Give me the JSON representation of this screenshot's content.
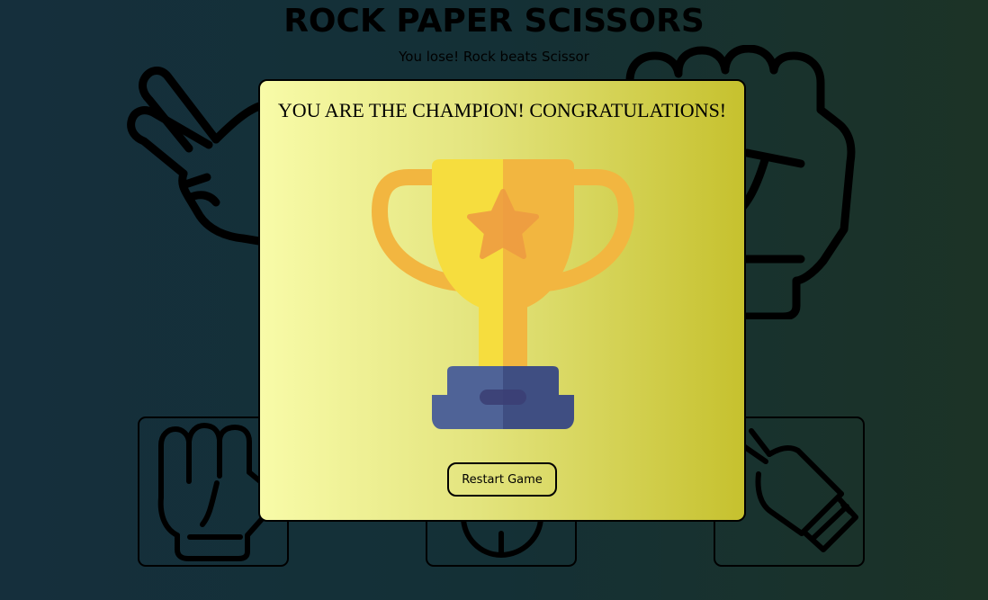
{
  "game": {
    "title": "ROCK PAPER SCISSORS",
    "round_result": "You lose! Rock beats Scissor"
  },
  "background_hands": {
    "left": "scissors-hand-icon",
    "right": "rock-fist-icon"
  },
  "choices": [
    {
      "id": "rock",
      "icon": "rock-fist-icon"
    },
    {
      "id": "paper",
      "icon": "paper-hand-icon"
    },
    {
      "id": "scissors",
      "icon": "scissors-hand-icon"
    }
  ],
  "modal": {
    "message": "YOU ARE THE CHAMPION! CONGRATULATIONS!",
    "icon": "trophy-icon",
    "restart_label": "Restart Game"
  },
  "colors": {
    "background_left": "#152f3c",
    "background_right": "#1c3326",
    "modal_gradient_left": "#f8fba8",
    "modal_gradient_right": "#c6c12e",
    "trophy_cup": "#f6dd3e",
    "trophy_cup_shade": "#f2b640",
    "trophy_handles": "#f2b640",
    "trophy_star": "#ee9a42",
    "trophy_base": "#4f6397",
    "trophy_base_shade": "#3f4e82"
  }
}
